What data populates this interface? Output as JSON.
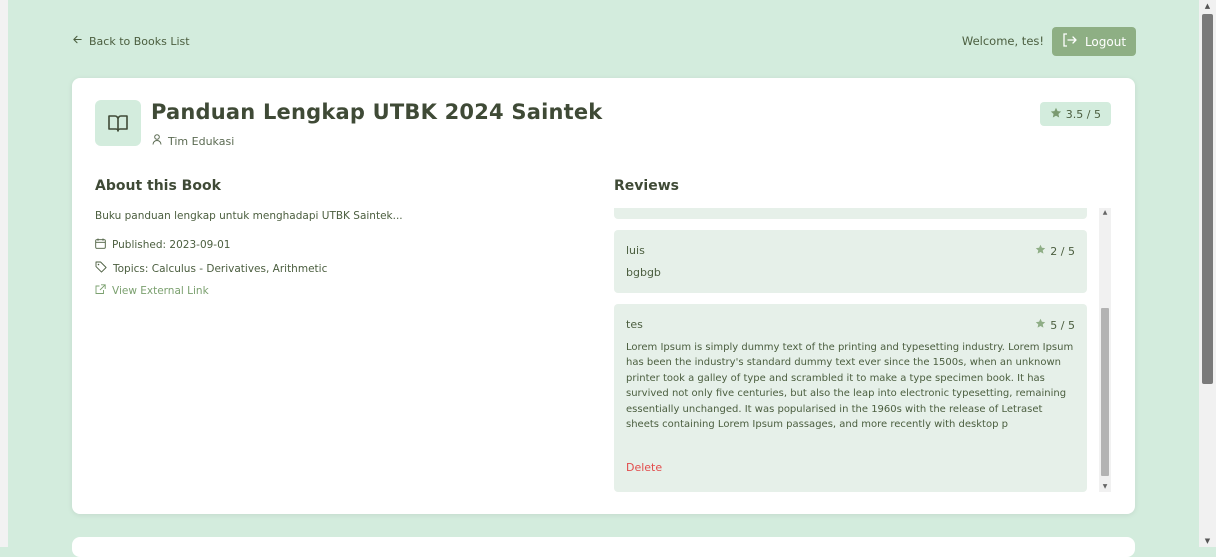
{
  "nav": {
    "back_label": "Back to Books List",
    "welcome_text": "Welcome, tes!",
    "logout_label": "Logout"
  },
  "book": {
    "title": "Panduan Lengkap UTBK 2024 Saintek",
    "author": "Tim Edukasi",
    "rating": "3.5 / 5",
    "about_heading": "About this Book",
    "description": "Buku panduan lengkap untuk menghadapi UTBK Saintek...",
    "published": "Published: 2023-09-01",
    "topics": "Topics: Calculus - Derivatives, Arithmetic",
    "external_link_label": "View External Link"
  },
  "reviews": {
    "heading": "Reviews",
    "items": [
      {
        "user": "luis",
        "rating": "2 / 5",
        "text": "bgbgb"
      },
      {
        "user": "tes",
        "rating": "5 / 5",
        "text": "Lorem Ipsum is simply dummy text of the printing and typesetting industry. Lorem Ipsum has been the industry's standard dummy text ever since the 1500s, when an unknown printer took a galley of type and scrambled it to make a type specimen book. It has survived not only five centuries, but also the leap into electronic typesetting, remaining essentially unchanged. It was popularised in the 1960s with the release of Letraset sheets containing Lorem Ipsum passages, and more recently with desktop p",
        "delete_label": "Delete"
      }
    ]
  },
  "colors": {
    "page_bg": "#d3ecdd",
    "accent": "#8eaf84",
    "review_bg": "#e6f0e9",
    "delete": "#e24b4b"
  },
  "icons": [
    "arrow-left-icon",
    "logout-icon",
    "book-open-icon",
    "user-icon",
    "star-icon",
    "calendar-icon",
    "tag-icon",
    "external-link-icon"
  ]
}
